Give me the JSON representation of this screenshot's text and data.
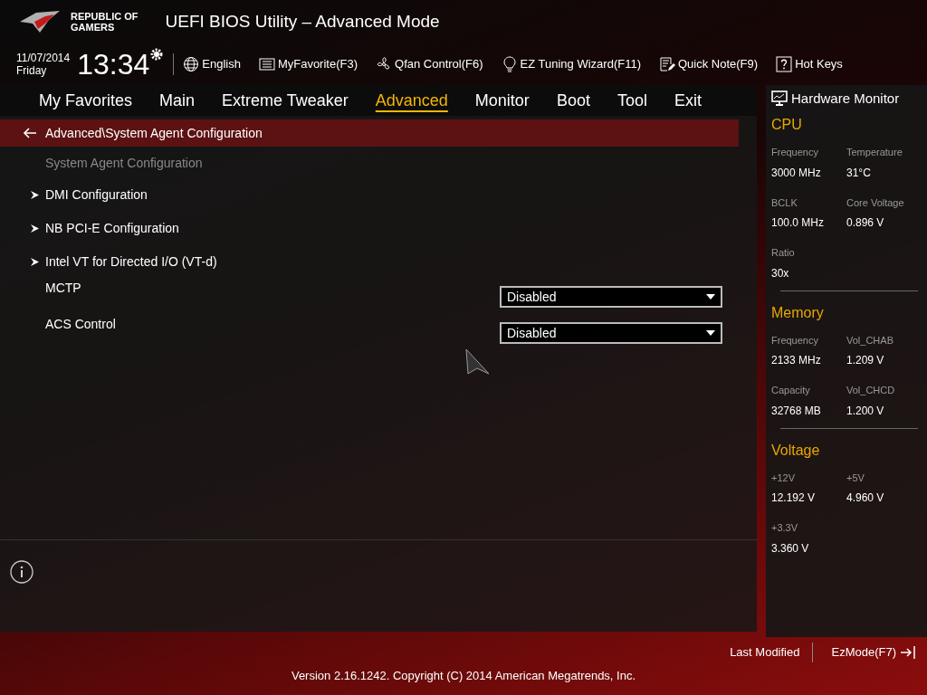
{
  "header": {
    "brand_line1": "REPUBLIC OF",
    "brand_line2": "GAMERS",
    "title": "UEFI BIOS Utility – Advanced Mode"
  },
  "toolbar": {
    "date": "11/07/2014",
    "day": "Friday",
    "time": "13:34",
    "items": [
      {
        "kind": "language",
        "label": "English"
      },
      {
        "kind": "favorite",
        "label": "MyFavorite(F3)"
      },
      {
        "kind": "fan",
        "label": "Qfan Control(F6)"
      },
      {
        "kind": "wizard",
        "label": "EZ Tuning Wizard(F11)"
      },
      {
        "kind": "note",
        "label": "Quick Note(F9)"
      },
      {
        "kind": "hotkeys",
        "label": "Hot Keys"
      }
    ]
  },
  "tabs": [
    {
      "label": "My Favorites",
      "selected": false
    },
    {
      "label": "Main",
      "selected": false
    },
    {
      "label": "Extreme Tweaker",
      "selected": false
    },
    {
      "label": "Advanced",
      "selected": true
    },
    {
      "label": "Monitor",
      "selected": false
    },
    {
      "label": "Boot",
      "selected": false
    },
    {
      "label": "Tool",
      "selected": false
    },
    {
      "label": "Exit",
      "selected": false
    }
  ],
  "breadcrumb": "Advanced\\System Agent Configuration",
  "section_title": "System Agent Configuration",
  "settings": [
    {
      "kind": "submenu",
      "label": "DMI Configuration"
    },
    {
      "kind": "submenu",
      "label": "NB PCI-E Configuration"
    },
    {
      "kind": "submenu",
      "label": "Intel VT for Directed I/O (VT-d)"
    },
    {
      "kind": "dropdown",
      "label": "MCTP",
      "value": "Disabled"
    },
    {
      "kind": "dropdown",
      "label": "ACS Control",
      "value": "Disabled"
    }
  ],
  "hardware_monitor": {
    "title": "Hardware Monitor",
    "sections": [
      {
        "title": "CPU",
        "fields": [
          {
            "label": "Frequency",
            "value": "3000 MHz"
          },
          {
            "label": "Temperature",
            "value": "31°C"
          },
          {
            "label": "BCLK",
            "value": "100.0 MHz"
          },
          {
            "label": "Core Voltage",
            "value": "0.896 V"
          },
          {
            "label": "Ratio",
            "value": "30x"
          }
        ]
      },
      {
        "title": "Memory",
        "fields": [
          {
            "label": "Frequency",
            "value": "2133 MHz"
          },
          {
            "label": "Vol_CHAB",
            "value": "1.209 V"
          },
          {
            "label": "Capacity",
            "value": "32768 MB"
          },
          {
            "label": "Vol_CHCD",
            "value": "1.200 V"
          }
        ]
      },
      {
        "title": "Voltage",
        "fields": [
          {
            "label": "+12V",
            "value": "12.192 V"
          },
          {
            "label": "+5V",
            "value": "4.960 V"
          },
          {
            "label": "+3.3V",
            "value": "3.360 V"
          }
        ]
      }
    ]
  },
  "footer": {
    "last_modified": "Last Modified",
    "ez_mode": "EzMode(F7)",
    "copyright": "Version 2.16.1242. Copyright (C) 2014 American Megatrends, Inc."
  }
}
